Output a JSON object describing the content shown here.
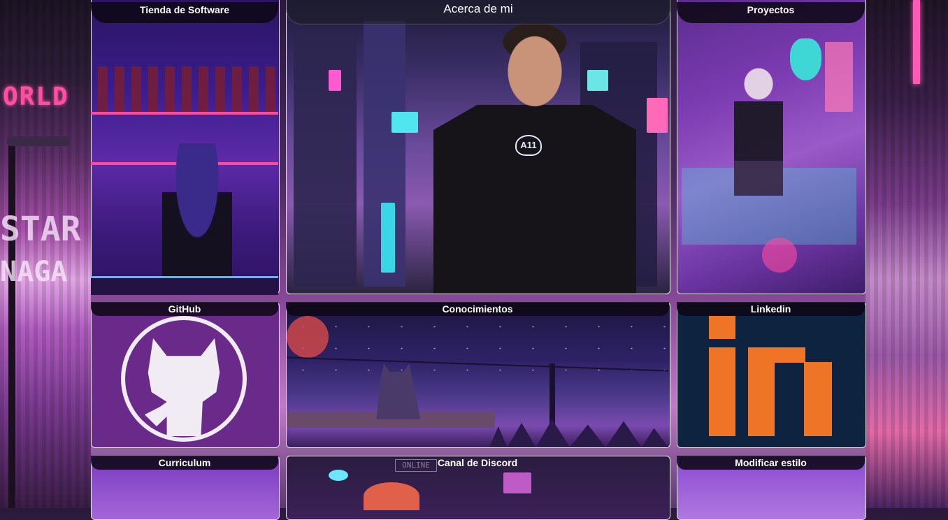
{
  "background": {
    "left_sign_1": "ORLD",
    "left_sign_2": "STAR",
    "left_sign_3": "NAGA"
  },
  "cards": {
    "store": {
      "title": "Tienda de Software"
    },
    "about": {
      "title": "Acerca de mi",
      "shirt_text": "A11"
    },
    "projects": {
      "title": "Proyectos"
    },
    "github": {
      "title": "GitHub"
    },
    "knowledge": {
      "title": "Conocimientos"
    },
    "linkedin": {
      "title": "Linkedin"
    },
    "cv": {
      "title": "Curriculum"
    },
    "discord": {
      "title": "Canal de Discord",
      "sign": "ONLINE"
    },
    "style": {
      "title": "Modificar estilo"
    }
  },
  "colors": {
    "accent_pink": "#ff4fa3",
    "linkedin_orange": "#f07425",
    "github_purple": "#6a2a8a",
    "title_bar": "#0e0816"
  }
}
